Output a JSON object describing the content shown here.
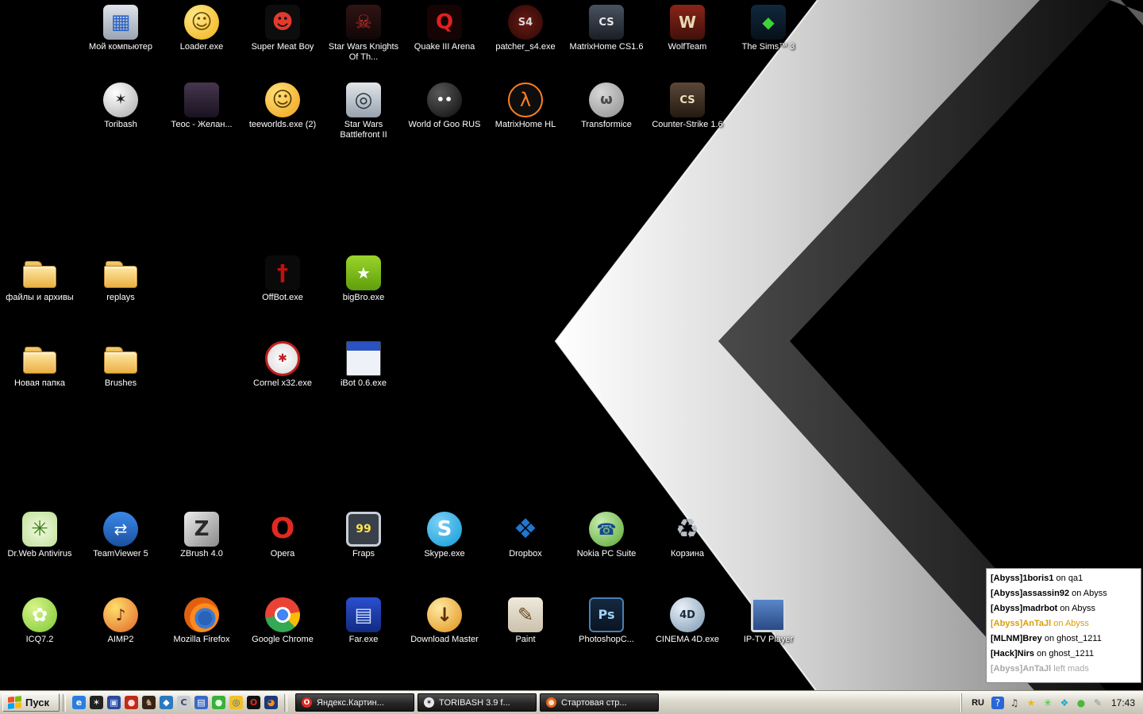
{
  "desktop": {
    "icons": [
      {
        "id": "my-computer",
        "label": "Мой компьютер",
        "icon": "my-computer",
        "col": 1,
        "row": 0,
        "kind": "tile",
        "bg": "linear-gradient(#dfe3ea,#9aa4b2)",
        "glyph": "▦",
        "fg": "#2a62c9",
        "gs": 26
      },
      {
        "id": "loader-exe",
        "label": "Loader.exe",
        "icon": "loader",
        "col": 2,
        "row": 0,
        "kind": "circle",
        "bg": "radial-gradient(circle at 35% 30%, #ffe98a, #f0b016)",
        "glyph": "☺",
        "fg": "#6b4a00",
        "gs": 26
      },
      {
        "id": "super-meat-boy",
        "label": "Super Meat Boy",
        "icon": "super-meat-boy",
        "col": 3,
        "row": 0,
        "kind": "tile",
        "bg": "#0d0d0d",
        "glyph": "☻",
        "fg": "#e23a2e",
        "gs": 26
      },
      {
        "id": "swkotor",
        "label": "Star Wars Knights Of Th...",
        "icon": "kotor",
        "col": 4,
        "row": 0,
        "kind": "tile",
        "bg": "linear-gradient(#301414,#100606)",
        "glyph": "☠",
        "fg": "#c03028",
        "gs": 24
      },
      {
        "id": "quake3",
        "label": "Quake III Arena",
        "icon": "quake3",
        "col": 5,
        "row": 0,
        "kind": "tile",
        "bg": "#160404",
        "glyph": "Q",
        "fg": "#e02020",
        "gs": 26,
        "gw": "bold"
      },
      {
        "id": "patcher-s4",
        "label": "patcher_s4.exe",
        "icon": "s4-league",
        "col": 6,
        "row": 0,
        "kind": "circle",
        "bg": "radial-gradient(#6a1a12,#2a0806)",
        "glyph": "S4",
        "fg": "#d8d8d8",
        "gs": 13,
        "gw": "bold"
      },
      {
        "id": "matrixhome-cs16",
        "label": "MatrixHome CS1.6",
        "icon": "counter-strike",
        "col": 7,
        "row": 0,
        "kind": "tile",
        "bg": "linear-gradient(#4a5260,#1a1e26)",
        "glyph": "CS",
        "fg": "#e8e8e8",
        "gs": 13,
        "gw": "bold"
      },
      {
        "id": "wolfteam",
        "label": "WolfTeam",
        "icon": "wolfteam",
        "col": 8,
        "row": 0,
        "kind": "tile",
        "bg": "linear-gradient(#8a2418,#40100a)",
        "glyph": "W",
        "fg": "#e8d9b0",
        "gs": 20,
        "gw": "bold"
      },
      {
        "id": "sims3",
        "label": "The Sims™ 3",
        "icon": "sims3-plumbob",
        "col": 9,
        "row": 0,
        "kind": "tile",
        "bg": "linear-gradient(#10283f,#071019)",
        "glyph": "◆",
        "fg": "#3fd435",
        "gs": 20
      },
      {
        "id": "toribash",
        "label": "Toribash",
        "icon": "toribash",
        "col": 1,
        "row": 1,
        "kind": "circle",
        "bg": "radial-gradient(circle at 35% 30%, #ffffff, #a8a8a8)",
        "glyph": "✶",
        "fg": "#1a1a1a",
        "gs": 18
      },
      {
        "id": "teos",
        "label": "Теос - Желан...",
        "icon": "teos-portrait",
        "col": 2,
        "row": 1,
        "kind": "tile",
        "bg": "linear-gradient(#46364e,#1a1220)"
      },
      {
        "id": "teeworlds",
        "label": "teeworlds.exe (2)",
        "icon": "teeworlds",
        "col": 3,
        "row": 1,
        "kind": "circle",
        "bg": "radial-gradient(circle at 35% 30%, #ffe27a, #eda018)",
        "glyph": "☺",
        "fg": "#5c3a00",
        "gs": 26
      },
      {
        "id": "battlefront2",
        "label": "Star Wars Battlefront II",
        "icon": "battlefront-helmet",
        "col": 4,
        "row": 1,
        "kind": "tile",
        "bg": "linear-gradient(#e2e6ea,#98a2ae)",
        "glyph": "◎",
        "fg": "#2a3440",
        "gs": 26
      },
      {
        "id": "world-of-goo",
        "label": "World of Goo RUS",
        "icon": "goo-ball",
        "col": 5,
        "row": 1,
        "kind": "circle",
        "bg": "radial-gradient(circle at 35% 30%, #585858, #0c0c0c)",
        "glyph": "••",
        "fg": "#ffffff",
        "gs": 16,
        "gw": "bold"
      },
      {
        "id": "matrixhome-hl",
        "label": "MatrixHome HL",
        "icon": "half-life-lambda",
        "col": 6,
        "row": 1,
        "kind": "circle",
        "bg": "#0e0e0e",
        "border": "2px solid #ff7f1f",
        "glyph": "λ",
        "fg": "#ff7f1f",
        "gs": 24
      },
      {
        "id": "transformice",
        "label": "Transformice",
        "icon": "transformice-mouse",
        "col": 7,
        "row": 1,
        "kind": "circle",
        "bg": "radial-gradient(circle at 35% 30%, #d8d8d8, #8e8e8e)",
        "glyph": "ω",
        "fg": "#4a4a4a",
        "gs": 18,
        "gw": "bold"
      },
      {
        "id": "cs16",
        "label": "Counter-Strike 1.6",
        "icon": "counter-strike",
        "col": 8,
        "row": 1,
        "kind": "tile",
        "bg": "linear-gradient(#5a4838,#241a10)",
        "glyph": "CS",
        "fg": "#f0e0c0",
        "gs": 13,
        "gw": "bold"
      },
      {
        "id": "files-archives",
        "label": "файлы и архивы",
        "icon": "folder",
        "col": 0,
        "row": 2,
        "kind": "folder"
      },
      {
        "id": "replays",
        "label": "replays",
        "icon": "folder",
        "col": 1,
        "row": 2,
        "kind": "folder"
      },
      {
        "id": "offbot",
        "label": "OffBot.exe",
        "icon": "offbot-brand",
        "col": 3,
        "row": 2,
        "kind": "tile",
        "bg": "#0a0a0a",
        "glyph": "†",
        "fg": "#c01010",
        "gs": 28,
        "gw": "bold"
      },
      {
        "id": "bigbro",
        "label": "bigBro.exe",
        "icon": "bigbro-star",
        "col": 4,
        "row": 2,
        "kind": "tile",
        "bg": "linear-gradient(#9ad42a,#5f9e0c)",
        "glyph": "★",
        "fg": "#ffffff",
        "gs": 20,
        "radius": 9
      },
      {
        "id": "new-folder",
        "label": "Новая папка",
        "icon": "folder",
        "col": 0,
        "row": 3,
        "kind": "folder"
      },
      {
        "id": "brushes",
        "label": "Brushes",
        "icon": "folder",
        "col": 1,
        "row": 3,
        "kind": "folder"
      },
      {
        "id": "cornel",
        "label": "Cornel x32.exe",
        "icon": "cornel-hand",
        "col": 3,
        "row": 3,
        "kind": "circle",
        "bg": "radial-gradient(#ffffff,#d8d8d8)",
        "border": "3px solid #c02020",
        "glyph": "✱",
        "fg": "#c02020",
        "gs": 14
      },
      {
        "id": "ibot",
        "label": "iBot 0.6.exe",
        "icon": "ibot-window",
        "col": 4,
        "row": 3,
        "kind": "tile",
        "bg": "linear-gradient(#2a52c0 0 11px, #eef2f8 11px)",
        "border": "1px solid #444444",
        "radius": 2
      },
      {
        "id": "drweb",
        "label": "Dr.Web Antivirus",
        "icon": "drweb-spider",
        "col": 0,
        "row": 4,
        "kind": "tile",
        "bg": "radial-gradient(#f0fae0,#bfe198)",
        "glyph": "✳",
        "fg": "#3a7d12",
        "gs": 26,
        "radius": 10
      },
      {
        "id": "teamviewer",
        "label": "TeamViewer 5",
        "icon": "teamviewer",
        "col": 1,
        "row": 4,
        "kind": "circle",
        "bg": "linear-gradient(#3a8ae8,#1b4fa0)",
        "glyph": "⇄",
        "fg": "#ffffff",
        "gs": 20
      },
      {
        "id": "zbrush",
        "label": "ZBrush 4.0",
        "icon": "zbrush",
        "col": 2,
        "row": 4,
        "kind": "tile",
        "bg": "linear-gradient(135deg,#ececec,#8a8a8a)",
        "glyph": "Z",
        "fg": "#2a2a2a",
        "gs": 26,
        "gw": "bold"
      },
      {
        "id": "opera",
        "label": "Opera",
        "icon": "opera",
        "col": 3,
        "row": 4,
        "kind": "circle",
        "bg": "transparent",
        "glyph": "O",
        "fg": "#e02a20",
        "gs": 36,
        "gw": "bold"
      },
      {
        "id": "fraps",
        "label": "Fraps",
        "icon": "fraps-monitor",
        "col": 4,
        "row": 4,
        "kind": "tile",
        "bg": "#39404a",
        "border": "3px solid #c9ced6",
        "glyph": "99",
        "fg": "#ffe34d",
        "gs": 14,
        "gw": "bold"
      },
      {
        "id": "skype",
        "label": "Skype.exe",
        "icon": "skype",
        "col": 5,
        "row": 4,
        "kind": "circle",
        "bg": "radial-gradient(circle at 35% 30%, #7cd0f5, #0f9bd7)",
        "glyph": "S",
        "fg": "#ffffff",
        "gs": 26,
        "gw": "bold"
      },
      {
        "id": "dropbox",
        "label": "Dropbox",
        "icon": "dropbox",
        "col": 6,
        "row": 4,
        "kind": "tile",
        "bg": "transparent",
        "glyph": "❖",
        "fg": "#1f77d0",
        "gs": 34
      },
      {
        "id": "nokia",
        "label": "Nokia PC Suite",
        "icon": "nokia-pc-suite",
        "col": 7,
        "row": 4,
        "kind": "circle",
        "bg": "radial-gradient(circle at 35% 30%, #c8ecb0, #5aa832)",
        "glyph": "☎",
        "fg": "#134a8e",
        "gs": 20
      },
      {
        "id": "recycle-bin",
        "label": "Корзина",
        "icon": "recycle-bin",
        "col": 8,
        "row": 4,
        "kind": "tile",
        "bg": "transparent",
        "glyph": "♻",
        "fg": "#b8bec6",
        "gs": 34
      },
      {
        "id": "icq",
        "label": "ICQ7.2",
        "icon": "icq-flower",
        "col": 0,
        "row": 5,
        "kind": "circle",
        "bg": "radial-gradient(circle at 35% 30%, #d8f58a, #7cc832)",
        "glyph": "✿",
        "fg": "#ffffff",
        "gs": 24
      },
      {
        "id": "aimp2",
        "label": "AIMP2",
        "icon": "aimp",
        "col": 1,
        "row": 5,
        "kind": "circle",
        "bg": "radial-gradient(circle at 35% 30%, #ffdf6a, #e0642a)",
        "glyph": "♪",
        "fg": "#6b1f0a",
        "gs": 20,
        "gw": "bold"
      },
      {
        "id": "firefox",
        "label": "Mozilla Firefox",
        "icon": "firefox",
        "col": 2,
        "row": 5,
        "kind": "circle",
        "bg": "radial-gradient(circle at 60% 60%, #2a62b8 0 9px, #3a7ad0 9px 13px, #ff8a1f 13px 19px, #e06010 19px)"
      },
      {
        "id": "chrome",
        "label": "Google Chrome",
        "icon": "chrome",
        "col": 3,
        "row": 5,
        "kind": "circle",
        "bg": "radial-gradient(circle, #4285f4 0 7px, #ffffff 7px 10px, rgba(0,0,0,0) 10px), conic-gradient(from -40deg, #ea4335 0 120deg, #fbbc05 120deg 175deg, #34a853 175deg 300deg, #ea4335 300deg)"
      },
      {
        "id": "far",
        "label": "Far.exe",
        "icon": "far-manager",
        "col": 4,
        "row": 5,
        "kind": "tile",
        "bg": "linear-gradient(#2a4fd0,#122a80)",
        "glyph": "▤",
        "fg": "#cfe0ff",
        "gs": 24
      },
      {
        "id": "download-master",
        "label": "Download Master",
        "icon": "download-master",
        "col": 5,
        "row": 5,
        "kind": "circle",
        "bg": "radial-gradient(circle at 35% 30%, #ffe9a0, #e09018)",
        "glyph": "↓",
        "fg": "#5a3000",
        "gs": 24,
        "gw": "bold"
      },
      {
        "id": "paint",
        "label": "Paint",
        "icon": "paint-brush",
        "col": 6,
        "row": 5,
        "kind": "tile",
        "bg": "linear-gradient(#efe9dc,#cbc2ac)",
        "glyph": "✎",
        "fg": "#6b4a20",
        "gs": 24
      },
      {
        "id": "photoshop",
        "label": "PhotoshopC...",
        "icon": "photoshop",
        "col": 7,
        "row": 5,
        "kind": "tile",
        "bg": "linear-gradient(#16293f,#0a1523)",
        "border": "2px solid #4a7fb5",
        "glyph": "Ps",
        "fg": "#9fd1f5",
        "gs": 16,
        "gw": "bold",
        "radius": 6
      },
      {
        "id": "cinema4d",
        "label": "CINEMA 4D.exe",
        "icon": "cinema4d-sphere",
        "col": 8,
        "row": 5,
        "kind": "circle",
        "bg": "radial-gradient(circle at 35% 30%, #e8f0f8, #7a96b0)",
        "glyph": "4D",
        "fg": "#1a2a3a",
        "gs": 13,
        "gw": "bold"
      },
      {
        "id": "iptv",
        "label": "IP-TV Player",
        "icon": "iptv-monitor",
        "col": 9,
        "row": 5,
        "kind": "tile",
        "bg": "linear-gradient(#5a86c8,#2a4a86)",
        "border": "3px solid #d4d9e0",
        "radius": 4
      }
    ]
  },
  "chat_overlay": {
    "lines": [
      {
        "name": "[Abyss]1boris1",
        "rest": " on qa1",
        "color": "#000000"
      },
      {
        "name": "[Abyss]assassin92",
        "rest": " on Abyss",
        "color": "#000000"
      },
      {
        "name": "[Abyss]madrbot",
        "rest": " on Abyss",
        "color": "#000000"
      },
      {
        "name": "[Abyss]AnTaJl",
        "rest": " on Abyss",
        "color": "#dc9e00"
      },
      {
        "name": "[MLNM]Brey",
        "rest": " on ghost_1211",
        "color": "#000000"
      },
      {
        "name": "[Hack]Nirs",
        "rest": " on ghost_1211",
        "color": "#000000"
      },
      {
        "name": "[Abyss]AnTaJl",
        "rest": " left mads",
        "color": "#a8a8a8"
      }
    ]
  },
  "taskbar": {
    "start": {
      "label": "Пуск",
      "flag_colors": [
        "#f25022",
        "#7fba00",
        "#00a4ef",
        "#ffb900"
      ]
    },
    "quick_launch": [
      {
        "name": "internet-explorer",
        "glyph": "e",
        "bg": "#2a7de0",
        "fg": "#ffffff"
      },
      {
        "name": "toribash-quicklaunch",
        "glyph": "✶",
        "bg": "#222222",
        "fg": "#eeeeee"
      },
      {
        "name": "save",
        "glyph": "▣",
        "bg": "#2a4a9e",
        "fg": "#cfe0ff"
      },
      {
        "name": "media-player",
        "glyph": "●",
        "bg": "#c02a1a",
        "fg": "#ffdddd"
      },
      {
        "name": "game",
        "glyph": "♞",
        "bg": "#33241a",
        "fg": "#caa87a"
      },
      {
        "name": "messenger",
        "glyph": "◆",
        "bg": "#2a7ac0",
        "fg": "#ffffff"
      },
      {
        "name": "cinema4d-quicklaunch",
        "glyph": "C",
        "bg": "#c8ccd4",
        "fg": "#444444"
      },
      {
        "name": "explorer-window",
        "glyph": "▤",
        "bg": "#3a6ac9",
        "fg": "#ffffff"
      },
      {
        "name": "nokia-quicklaunch",
        "glyph": "●",
        "bg": "#3ab03a",
        "fg": "#e0ffe0"
      },
      {
        "name": "chrome-quicklaunch",
        "glyph": "◎",
        "bg": "#f0c02a",
        "fg": "#2a62c9"
      },
      {
        "name": "opera-quicklaunch",
        "glyph": "O",
        "bg": "#111111",
        "fg": "#e02a20"
      },
      {
        "name": "firefox-quicklaunch",
        "glyph": "◕",
        "bg": "#1a3a7a",
        "fg": "#ff8a1f"
      }
    ],
    "tasks": [
      {
        "id": "yandex-images",
        "label": "Яндекс.Картин...",
        "icon": "opera-task",
        "icon_bg": "#e02a20",
        "icon_fg": "#ffffff",
        "icon_glyph": "O"
      },
      {
        "id": "toribash-window",
        "label": "TORIBASH 3.9 f...",
        "icon": "toribash-task",
        "icon_bg": "#e8e8e8",
        "icon_fg": "#222222",
        "icon_glyph": "✶"
      },
      {
        "id": "start-page",
        "label": "Стартовая стр...",
        "icon": "browser-task",
        "icon_bg": "#e8641f",
        "icon_fg": "#ffe2c0",
        "icon_glyph": "●"
      }
    ],
    "tray": {
      "lang": "RU",
      "time": "17:43",
      "icons": [
        {
          "name": "help",
          "glyph": "?",
          "bg": "#2a66d8",
          "fg": "#ffffff"
        },
        {
          "name": "volume",
          "glyph": "♫",
          "fg": "#3a3a3a"
        },
        {
          "name": "update-star",
          "glyph": "★",
          "fg": "#e8b820"
        },
        {
          "name": "antivirus-tray",
          "glyph": "✳",
          "fg": "#3ac83a"
        },
        {
          "name": "dropbox-tray",
          "glyph": "❖",
          "fg": "#18a8c8"
        },
        {
          "name": "agent",
          "glyph": "●",
          "fg": "#4ab83a"
        },
        {
          "name": "pencil",
          "glyph": "✎",
          "fg": "#8a929a"
        }
      ]
    }
  }
}
